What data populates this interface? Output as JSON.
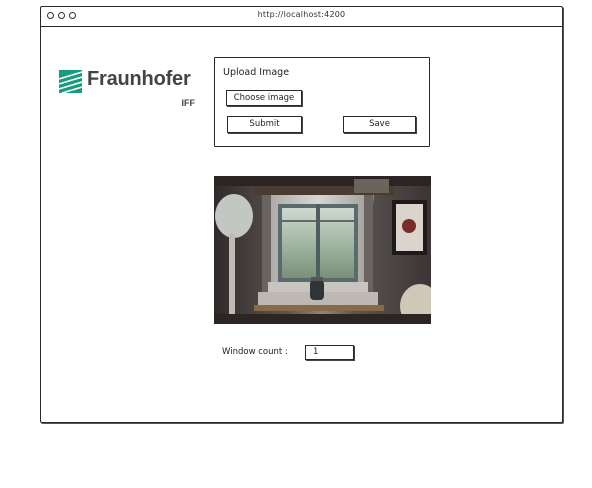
{
  "browser": {
    "url": "http://localhost:4200"
  },
  "logo": {
    "wordmark": "Fraunhofer",
    "sub": "IFF",
    "brand_color": "#179c7d"
  },
  "upload": {
    "title": "Upload Image",
    "choose_label": "Choose image",
    "submit_label": "Submit",
    "save_label": "Save"
  },
  "result": {
    "count_label": "Window count :",
    "count_value": "1"
  }
}
